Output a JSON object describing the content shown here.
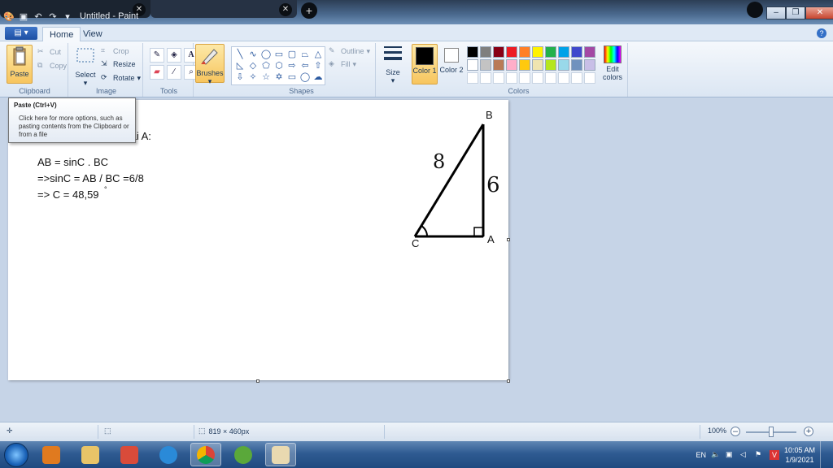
{
  "window": {
    "title": "Untitled - Paint",
    "browser_tab_1": "",
    "browser_tab_2": ""
  },
  "ribbon": {
    "file_menu_label": "",
    "tabs": [
      "Home",
      "View"
    ],
    "groups": {
      "clipboard": {
        "label": "Clipboard",
        "paste": "Paste",
        "cut": "Cut",
        "copy": "Copy"
      },
      "image": {
        "label": "Image",
        "select": "Select",
        "crop": "Crop",
        "resize": "Resize",
        "rotate": "Rotate"
      },
      "tools": {
        "label": "Tools"
      },
      "brushes": {
        "label": "Brushes"
      },
      "shapes": {
        "label": "Shapes",
        "outline": "Outline",
        "fill": "Fill"
      },
      "size": {
        "label": "Size"
      },
      "colors": {
        "label": "Colors",
        "color1": "Color 1",
        "color2": "Color 2",
        "edit_colors": "Edit colors"
      }
    }
  },
  "palette": {
    "row1": [
      "#000000",
      "#7f7f7f",
      "#880015",
      "#ed1c24",
      "#ff7f27",
      "#fff200",
      "#22b14c",
      "#00a2e8",
      "#3f48cc",
      "#a349a4"
    ],
    "row2": [
      "#ffffff",
      "#c3c3c3",
      "#b97a57",
      "#ffaec9",
      "#ffc90e",
      "#efe4b0",
      "#b5e61d",
      "#99d9ea",
      "#7092be",
      "#c8bfe7"
    ],
    "color1": "#000000",
    "color2": "#ffffff"
  },
  "tooltip": {
    "title": "Paste (Ctrl+V)",
    "body": "Click here for more options, such as pasting contents from the Clipboard or from a file"
  },
  "canvas": {
    "line0": "tại A:",
    "line1": "AB = sinC . BC",
    "line2": "=>sinC = AB / BC =6/8",
    "line3": "=> C = 48,59",
    "degree_mark": "°",
    "vertex_b": "B",
    "vertex_a": "A",
    "vertex_c": "C",
    "hypotenuse_label": "8",
    "side_label": "6"
  },
  "statusbar": {
    "dimensions": "819 × 460px",
    "zoom": "100%"
  },
  "taskbar": {
    "language": "EN",
    "time": "10:05 AM",
    "date": "1/9/2021"
  }
}
